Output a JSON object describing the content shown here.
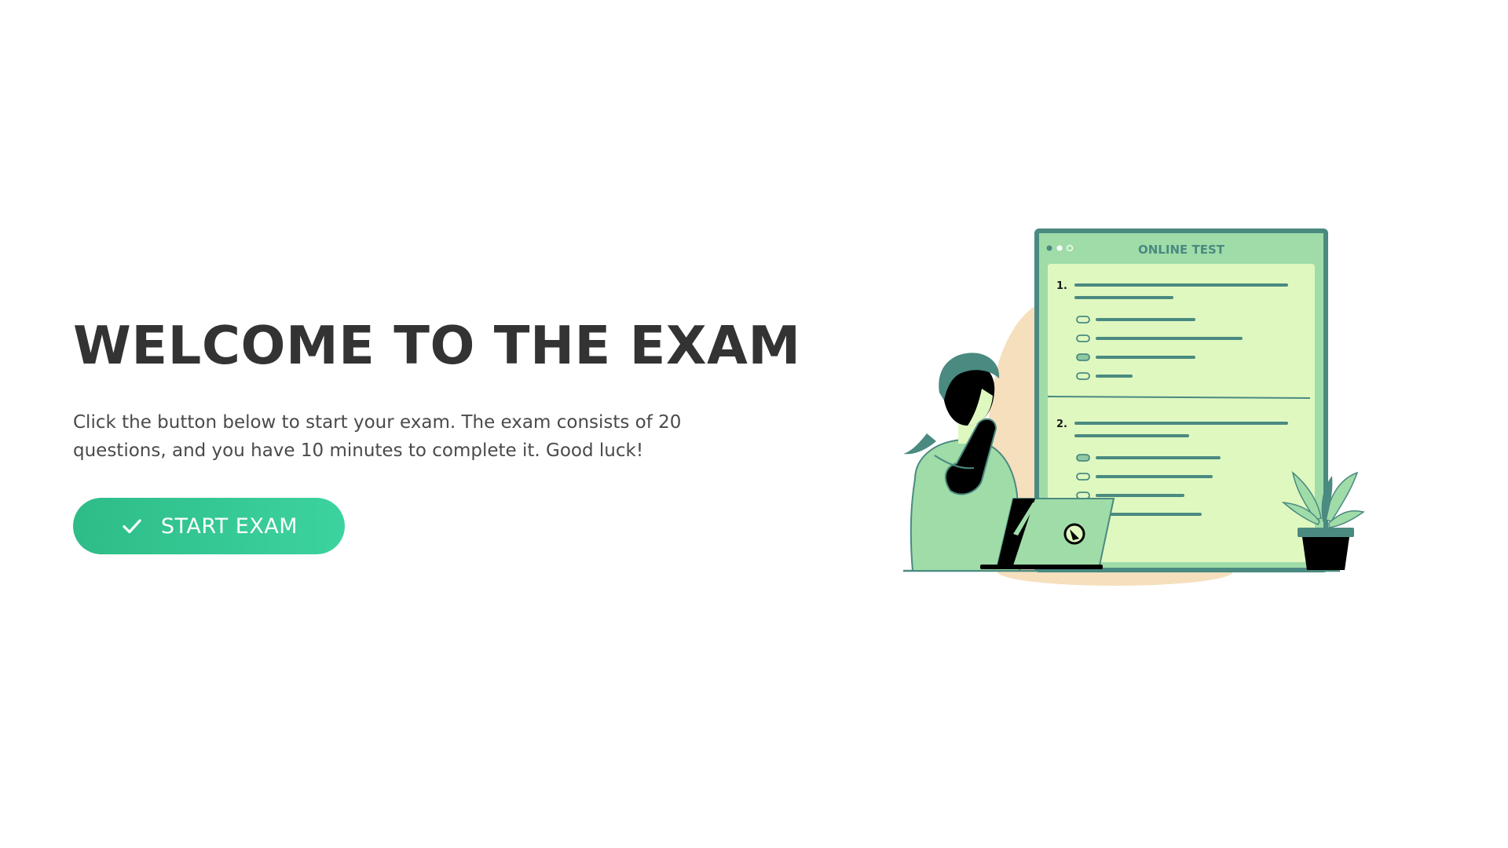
{
  "hero": {
    "title": "WELCOME TO THE EXAM",
    "description": "Click the button below to start your exam. The exam consists of 20 questions, and you have 10 minutes to complete it. Good luck!",
    "start_button_label": "START EXAM",
    "start_button_icon": "check-icon"
  },
  "illustration": {
    "screen_title": "ONLINE TEST",
    "question_1_number": "1.",
    "question_2_number": "2."
  },
  "colors": {
    "accent_start": "#2ebc88",
    "accent_end": "#3cd39f",
    "title_text": "#333333",
    "body_text": "#4a4a4a",
    "illustration_teal": "#4a8a80",
    "illustration_light_green": "#dff8c0",
    "illustration_mid_green": "#a0dca8",
    "illustration_peach": "#f5dfbd"
  }
}
